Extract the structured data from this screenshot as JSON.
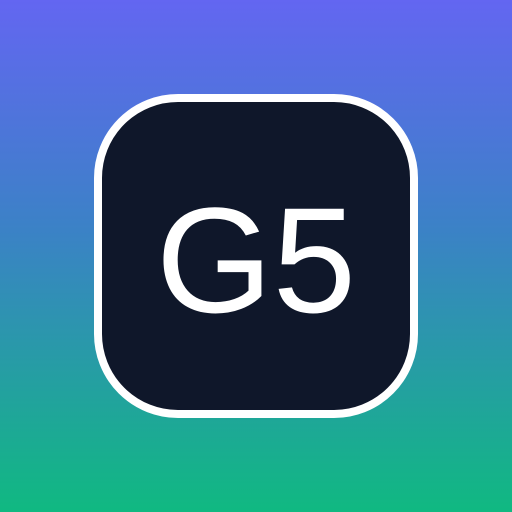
{
  "icon": {
    "label": "G5",
    "tile_color": "#0F172A",
    "border_color": "#FFFFFF",
    "text_color": "#FFFFFF",
    "background_gradient": [
      "#6366F1",
      "#3B82C6",
      "#10B981"
    ]
  }
}
